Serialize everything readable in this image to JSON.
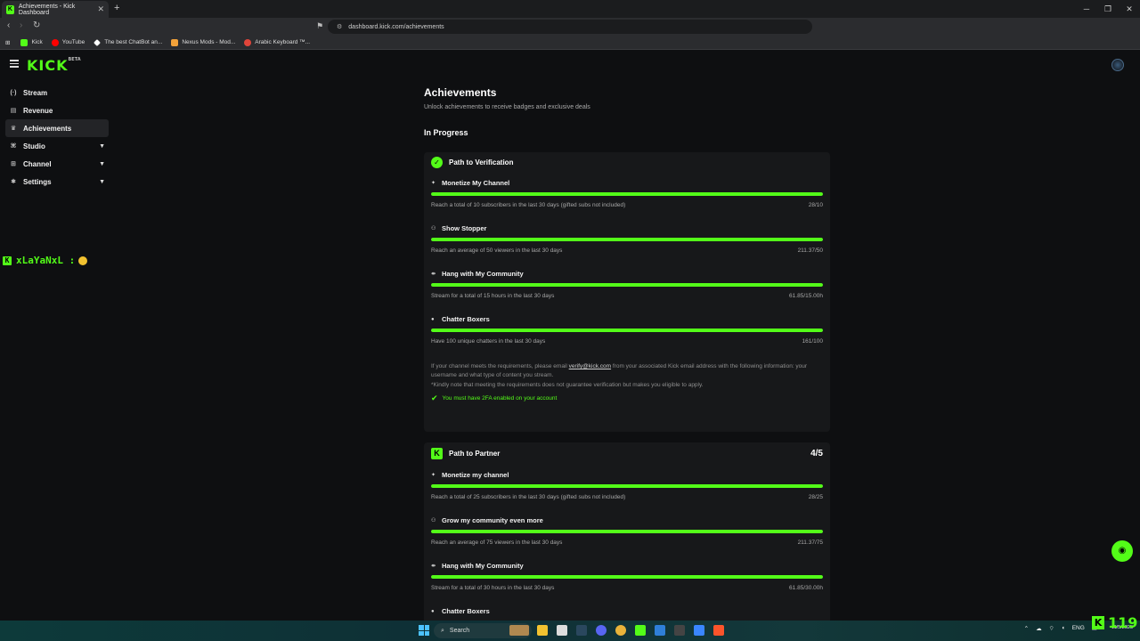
{
  "browser": {
    "tab_title": "Achievements - Kick Dashboard",
    "tab_close": "✕",
    "new_tab": "+",
    "url": "dashboard.kick.com/achievements",
    "bookmarks": [
      {
        "label": "Kick",
        "color": "#53fc18"
      },
      {
        "label": "YouTube",
        "color": "#ff0000"
      },
      {
        "label": "The best ChatBot an...",
        "color": "#ffffff"
      },
      {
        "label": "Nexus Mods - Mod...",
        "color": "#f2a23a"
      },
      {
        "label": "Arabic Keyboard ™...",
        "color": "#e0453a"
      }
    ]
  },
  "app": {
    "logo": "KICK",
    "logo_tm": "BETA",
    "accent": "#53fc18"
  },
  "sidebar": {
    "items": [
      {
        "label": "Stream",
        "icon": "broadcast-icon",
        "glyph": "((·))",
        "active": false,
        "expandable": false
      },
      {
        "label": "Revenue",
        "icon": "wallet-icon",
        "glyph": "▤",
        "active": false,
        "expandable": false
      },
      {
        "label": "Achievements",
        "icon": "trophy-icon",
        "glyph": "🏆",
        "active": true,
        "expandable": false
      },
      {
        "label": "Studio",
        "icon": "studio-icon",
        "glyph": "⚙",
        "active": false,
        "expandable": true
      },
      {
        "label": "Channel",
        "icon": "channel-icon",
        "glyph": "⊞",
        "active": false,
        "expandable": true
      },
      {
        "label": "Settings",
        "icon": "settings-icon",
        "glyph": "✱",
        "active": false,
        "expandable": true
      }
    ]
  },
  "chat_overlay": {
    "username": "xLaYaNxL :"
  },
  "main": {
    "title": "Achievements",
    "subtitle": "Unlock achievements to receive badges and exclusive deals",
    "section": "In Progress",
    "verification": {
      "title": "Path to Verification",
      "tasks": [
        {
          "name": "Monetize My Channel",
          "desc": "Reach a total of 10 subscribers in the last 30 days (gifted subs not included)",
          "value": "28/10",
          "progress": 1.0
        },
        {
          "name": "Show Stopper",
          "desc": "Reach an average of 50 viewers in the last 30 days",
          "value": "211.37/50",
          "progress": 1.0
        },
        {
          "name": "Hang with My Community",
          "desc": "Stream for a total of 15 hours in the last 30 days",
          "value": "61.85/15.00h",
          "progress": 1.0
        },
        {
          "name": "Chatter Boxers",
          "desc": "Have 100 unique chatters in the last 30 days",
          "value": "161/100",
          "progress": 1.0
        }
      ],
      "note_pre": "If your channel meets the requirements, please email ",
      "note_link": "verify@kick.com",
      "note_post": " from your associated Kick email address with the following information: your username and what type of content you stream.",
      "note2": "*Kindly note that meeting the requirements does not guarantee verification but makes you eligible to apply.",
      "twofa": "You must have 2FA enabled on your account"
    },
    "partner": {
      "title": "Path to Partner",
      "count": "4/5",
      "tasks": [
        {
          "name": "Monetize my channel",
          "desc": "Reach a total of 25 subscribers in the last 30 days (gifted subs not included)",
          "value": "28/25",
          "progress": 1.0
        },
        {
          "name": "Grow my community even more",
          "desc": "Reach an average of 75 viewers in the last 30 days",
          "value": "211.37/75",
          "progress": 1.0
        },
        {
          "name": "Hang with My Community",
          "desc": "Stream for a total of 30 hours in the last 30 days",
          "value": "61.85/30.00h",
          "progress": 1.0
        },
        {
          "name": "Chatter Boxers",
          "desc": "",
          "value": "",
          "progress": 1.0
        }
      ]
    }
  },
  "overlay": {
    "viewer_count": "119"
  },
  "taskbar": {
    "search": "Search",
    "lang": "ENG",
    "date": "11/5/2025"
  }
}
